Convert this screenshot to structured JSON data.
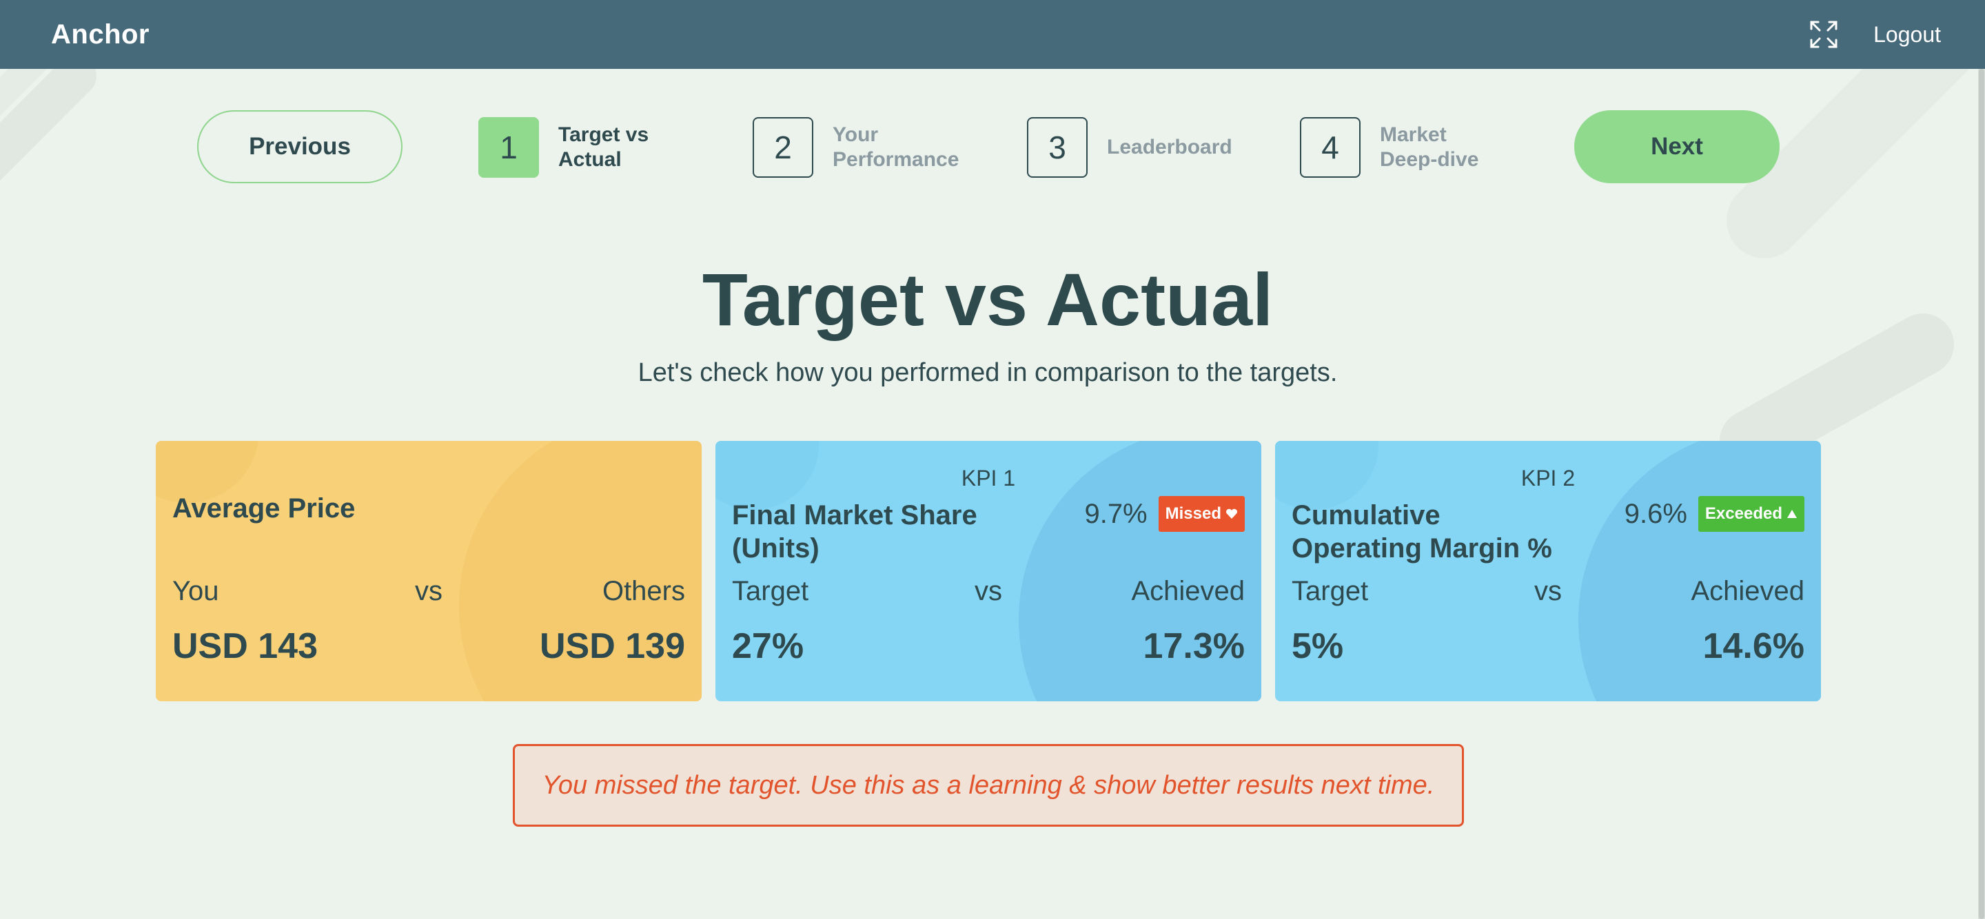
{
  "header": {
    "brand": "Anchor",
    "logout_label": "Logout",
    "expand_icon": "expand-icon"
  },
  "nav": {
    "previous_label": "Previous",
    "next_label": "Next",
    "steps": [
      {
        "number": "1",
        "label_line1": "Target vs",
        "label_line2": "Actual",
        "active": true
      },
      {
        "number": "2",
        "label_line1": "Your",
        "label_line2": "Performance",
        "active": false
      },
      {
        "number": "3",
        "label_line1": "Leaderboard",
        "label_line2": "",
        "active": false
      },
      {
        "number": "4",
        "label_line1": "Market",
        "label_line2": "Deep-dive",
        "active": false
      }
    ]
  },
  "page": {
    "title": "Target vs Actual",
    "subtitle": "Let's check how you performed in comparison to the targets."
  },
  "cards": [
    {
      "title": "Average Price",
      "left_label": "You",
      "vs": "vs",
      "right_label": "Others",
      "left_value": "USD 143",
      "right_value": "USD 139",
      "color": "#f7d078"
    },
    {
      "tag": "KPI 1",
      "title_line1": "Final Market Share",
      "title_line2": "(Units)",
      "metric": "9.7%",
      "badge": "Missed",
      "badge_icon": "heart-down-icon",
      "badge_color": "#e9542d",
      "left_label": "Target",
      "vs": "vs",
      "right_label": "Achieved",
      "left_value": "27%",
      "right_value": "17.3%",
      "color": "#85d6f4"
    },
    {
      "tag": "KPI 2",
      "title_line1": "Cumulative",
      "title_line2": "Operating Margin %",
      "metric": "9.6%",
      "badge": "Exceeded",
      "badge_icon": "triangle-up-icon",
      "badge_color": "#4cba3a",
      "left_label": "Target",
      "vs": "vs",
      "right_label": "Achieved",
      "left_value": "5%",
      "right_value": "14.6%",
      "color": "#85d6f4"
    }
  ],
  "message": "You missed the target. Use this as a learning & show better results next time."
}
